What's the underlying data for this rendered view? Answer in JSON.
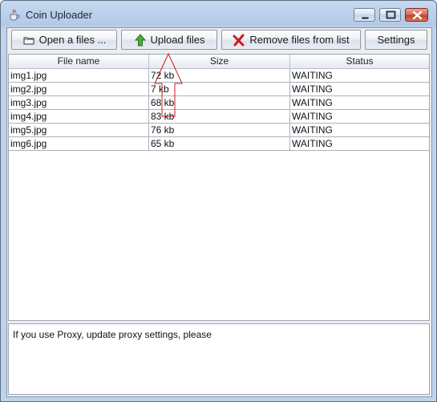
{
  "window": {
    "title": "Coin Uploader"
  },
  "toolbar": {
    "open_label": "Open a files ...",
    "upload_label": "Upload files",
    "remove_label": "Remove files from list",
    "settings_label": "Settings"
  },
  "icons": {
    "app": "java-cup-icon",
    "open": "folder-icon",
    "upload": "green-up-arrow-icon",
    "remove": "red-x-icon"
  },
  "table": {
    "columns": [
      "File name",
      "Size",
      "Status"
    ],
    "rows": [
      {
        "name": "img1.jpg",
        "size": "72 kb",
        "status": "WAITING"
      },
      {
        "name": "img2.jpg",
        "size": "7 kb",
        "status": "WAITING"
      },
      {
        "name": "img3.jpg",
        "size": "68 kb",
        "status": "WAITING"
      },
      {
        "name": "img4.jpg",
        "size": "83 kb",
        "status": "WAITING"
      },
      {
        "name": "img5.jpg",
        "size": "76 kb",
        "status": "WAITING"
      },
      {
        "name": "img6.jpg",
        "size": "65 kb",
        "status": "WAITING"
      }
    ]
  },
  "message": {
    "text": "If you use Proxy, update proxy settings, please"
  },
  "colors": {
    "annotation": "#cc1a1a",
    "upload_arrow": "#3fa532",
    "remove_x": "#d11a1a",
    "close_button": "#c8452c"
  }
}
